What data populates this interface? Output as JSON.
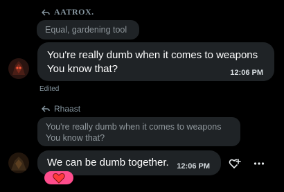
{
  "message1": {
    "reply_to_name": "AATROX.",
    "quoted_text": "Equal, gardening tool",
    "line1": "You're really dumb when it comes to weapons",
    "line2": "You know that?",
    "time": "12:06 PM",
    "edited": "Edited"
  },
  "message2": {
    "reply_to_name": "Rhaast",
    "quoted_line1": "You're really dumb when it comes to weapons",
    "quoted_line2": "You know that?",
    "text": "We can be dumb together.",
    "time": "12:06 PM",
    "reaction_icon": "heart-icon",
    "reaction_color": "#ff4d8d"
  },
  "colors": {
    "background": "#000000",
    "bubble": "#1f2326",
    "muted_text": "#8696a0"
  }
}
